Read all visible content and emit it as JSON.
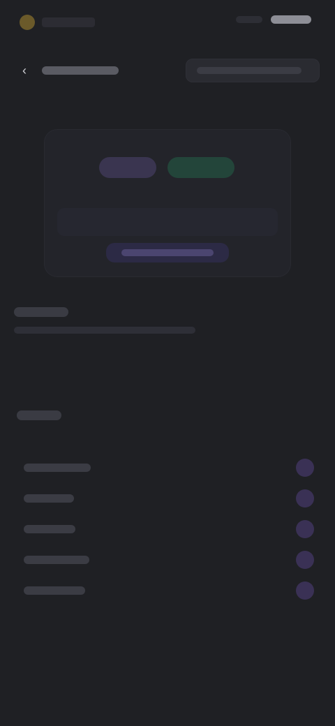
{
  "topbar": {
    "brand_name": "",
    "right_placeholders": [
      "",
      ""
    ]
  },
  "actions": {
    "back_label": "",
    "search_placeholder": ""
  },
  "card": {
    "toggle_purple": "",
    "toggle_green": "",
    "description": "",
    "cta_label": ""
  },
  "section1": {
    "title": "",
    "subtitle": ""
  },
  "section2": {
    "title": "",
    "items": [
      {
        "label": "",
        "badge": ""
      },
      {
        "label": "",
        "badge": ""
      },
      {
        "label": "",
        "badge": ""
      },
      {
        "label": "",
        "badge": ""
      },
      {
        "label": "",
        "badge": ""
      }
    ]
  },
  "colors": {
    "background": "#1f2024",
    "accent_purple": "#b9a7ef",
    "accent_green": "#59d3a2"
  }
}
